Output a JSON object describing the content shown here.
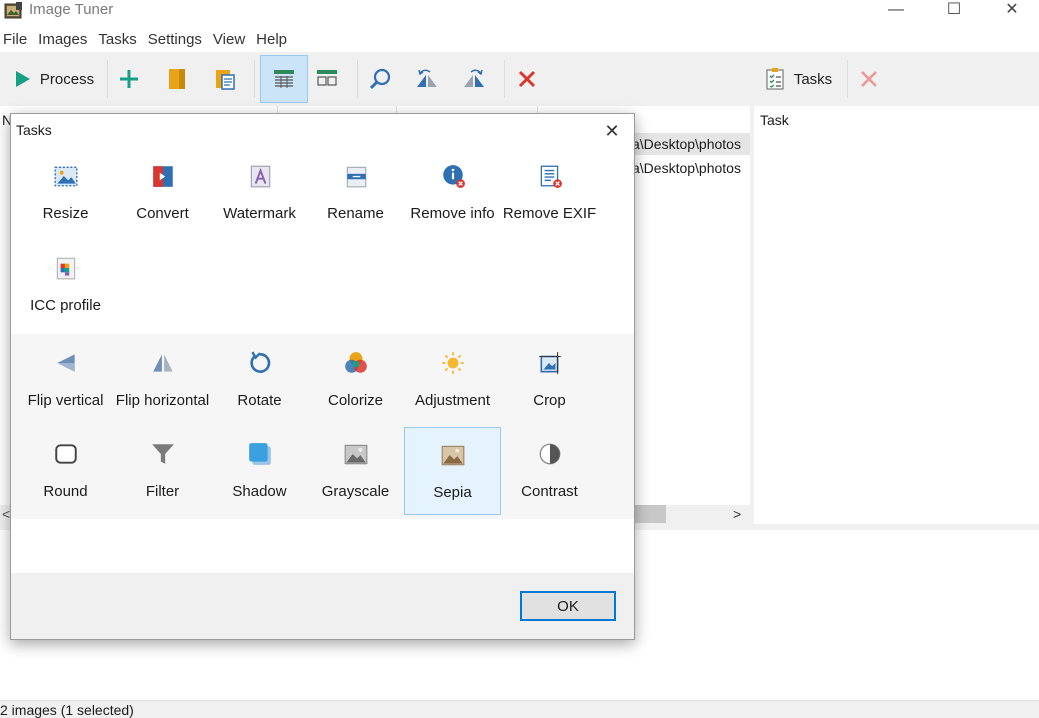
{
  "window": {
    "title": "Image Tuner",
    "minimize": "—",
    "maximize": "☐",
    "close": "✕"
  },
  "menu": [
    "File",
    "Images",
    "Tasks",
    "Settings",
    "View",
    "Help"
  ],
  "toolbar": {
    "process_label": "Process",
    "tasks_label": "Tasks"
  },
  "list": {
    "header_first": "N",
    "rows": [
      "a\\Desktop\\photos",
      "a\\Desktop\\photos"
    ]
  },
  "right_pane": {
    "header": "Task"
  },
  "status": "2 images (1 selected)",
  "dialog": {
    "title": "Tasks",
    "close": "✕",
    "ok_label": "OK",
    "tasks": [
      {
        "label": "Resize",
        "icon": "resize-icon"
      },
      {
        "label": "Convert",
        "icon": "convert-icon"
      },
      {
        "label": "Watermark",
        "icon": "watermark-icon"
      },
      {
        "label": "Rename",
        "icon": "rename-icon"
      },
      {
        "label": "Remove info",
        "icon": "remove-info-icon"
      },
      {
        "label": "Remove EXIF",
        "icon": "remove-exif-icon"
      },
      {
        "label": "ICC profile",
        "icon": "icc-profile-icon"
      }
    ],
    "effects": [
      {
        "label": "Flip vertical",
        "icon": "flip-vertical-icon"
      },
      {
        "label": "Flip horizontal",
        "icon": "flip-horizontal-icon"
      },
      {
        "label": "Rotate",
        "icon": "rotate-icon"
      },
      {
        "label": "Colorize",
        "icon": "colorize-icon"
      },
      {
        "label": "Adjustment",
        "icon": "adjustment-icon"
      },
      {
        "label": "Crop",
        "icon": "crop-icon"
      },
      {
        "label": "Round",
        "icon": "round-icon"
      },
      {
        "label": "Filter",
        "icon": "filter-icon"
      },
      {
        "label": "Shadow",
        "icon": "shadow-icon"
      },
      {
        "label": "Grayscale",
        "icon": "grayscale-icon"
      },
      {
        "label": "Sepia",
        "icon": "sepia-icon",
        "selected": true
      },
      {
        "label": "Contrast",
        "icon": "contrast-icon"
      }
    ]
  },
  "colors": {
    "accent": "#0078d7",
    "selection": "#e5f3ff",
    "process_green": "#16a085",
    "delete_red": "#d9362e"
  }
}
